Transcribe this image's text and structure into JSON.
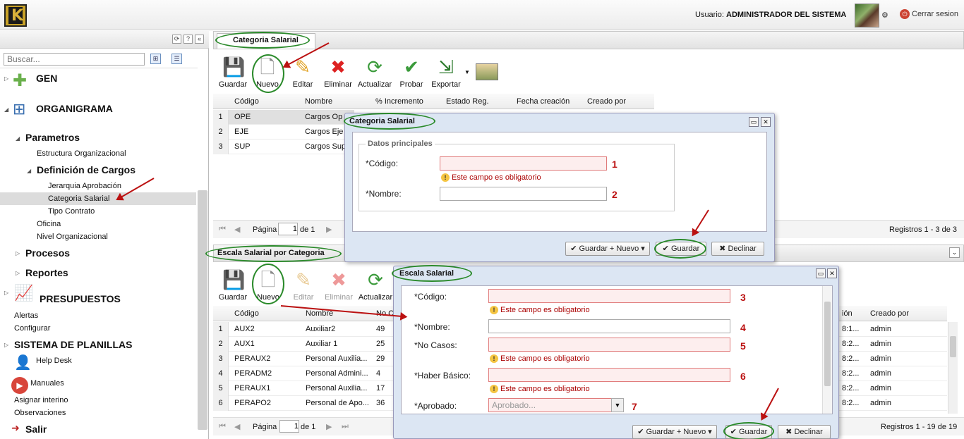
{
  "header": {
    "user_label": "Usuario:",
    "user_name": "ADMINISTRADOR DEL SISTEMA",
    "logout": "Cerrar sesion"
  },
  "sidebar": {
    "search_placeholder": "Buscar...",
    "gen": "GEN",
    "organigrama": "ORGANIGRAMA",
    "parametros": "Parametros",
    "estructura": "Estructura Organizacional",
    "definicion": "Definición de Cargos",
    "jerarquia": "Jerarquia Aprobación",
    "categoria": "Categoria Salarial",
    "tipo": "Tipo Contrato",
    "oficina": "Oficina",
    "nivel": "Nivel Organizacional",
    "procesos": "Procesos",
    "reportes": "Reportes",
    "presupuestos": "PRESUPUESTOS",
    "alertas": "Alertas",
    "configurar": "Configurar",
    "planillas": "SISTEMA DE PLANILLAS",
    "helpdesk": "Help Desk",
    "manuales": "Manuales",
    "asignar": "Asignar interino",
    "observaciones": "Observaciones",
    "salir": "Salir"
  },
  "top_panel": {
    "tab": "Categoria Salarial",
    "tools": {
      "guardar": "Guardar",
      "nuevo": "Nuevo",
      "editar": "Editar",
      "eliminar": "Eliminar",
      "actualizar": "Actualizar",
      "probar": "Probar",
      "exportar": "Exportar"
    },
    "columns": [
      "Código",
      "Nombre",
      "% Incremento",
      "Estado Reg.",
      "Fecha creación",
      "Creado por"
    ],
    "rows": [
      {
        "n": "1",
        "codigo": "OPE",
        "nombre": "Cargos Op"
      },
      {
        "n": "2",
        "codigo": "EJE",
        "nombre": "Cargos Eje"
      },
      {
        "n": "3",
        "codigo": "SUP",
        "nombre": "Cargos Sup"
      }
    ],
    "pager": {
      "pagina": "Página",
      "page": "1",
      "de": "de 1",
      "registros": "Registros 1 - 3 de 3"
    }
  },
  "dialog1": {
    "title": "Categoria Salarial",
    "legend": "Datos principales",
    "codigo": "*Código:",
    "nombre": "*Nombre:",
    "error": "Este campo es obligatorio",
    "n1": "1",
    "n2": "2",
    "guardar_nuevo": "Guardar + Nuevo",
    "guardar": "Guardar",
    "declinar": "Declinar"
  },
  "bottom_panel": {
    "tab": "Escala Salarial por Categoria",
    "tools": {
      "guardar": "Guardar",
      "nuevo": "Nuevo",
      "editar": "Editar",
      "eliminar": "Eliminar",
      "actualizar": "Actualizar"
    },
    "columns": {
      "codigo": "Código",
      "nombre": "Nombre",
      "nocasos": "No C",
      "fecha": "ión",
      "creado": "Creado por"
    },
    "rows": [
      {
        "n": "1",
        "codigo": "AUX2",
        "nombre": "Auxiliar2",
        "no": "49",
        "f": "8:1...",
        "c": "admin"
      },
      {
        "n": "2",
        "codigo": "AUX1",
        "nombre": "Auxiliar 1",
        "no": "25",
        "f": "8:2...",
        "c": "admin"
      },
      {
        "n": "3",
        "codigo": "PERAUX2",
        "nombre": "Personal Auxilia...",
        "no": "29",
        "f": "8:2...",
        "c": "admin"
      },
      {
        "n": "4",
        "codigo": "PERADM2",
        "nombre": "Personal Admini...",
        "no": "4",
        "f": "8:2...",
        "c": "admin"
      },
      {
        "n": "5",
        "codigo": "PERAUX1",
        "nombre": "Personal Auxilia...",
        "no": "17",
        "f": "8:2...",
        "c": "admin"
      },
      {
        "n": "6",
        "codigo": "PERAPO2",
        "nombre": "Personal de Apo...",
        "no": "36",
        "f": "8:2...",
        "c": "admin"
      }
    ],
    "pager": {
      "pagina": "Página",
      "page": "1",
      "de": "de 1",
      "registros": "Registros 1 - 19 de 19"
    }
  },
  "dialog2": {
    "title": "Escala Salarial",
    "codigo": "*Código:",
    "nombre": "*Nombre:",
    "nocasos": "*No Casos:",
    "haber": "*Haber Básico:",
    "aprobado": "*Aprobado:",
    "aprobado_placeholder": "Aprobado...",
    "error": "Este campo es obligatorio",
    "n3": "3",
    "n4": "4",
    "n5": "5",
    "n6": "6",
    "n7": "7",
    "guardar_nuevo": "Guardar + Nuevo",
    "guardar": "Guardar",
    "declinar": "Declinar"
  }
}
